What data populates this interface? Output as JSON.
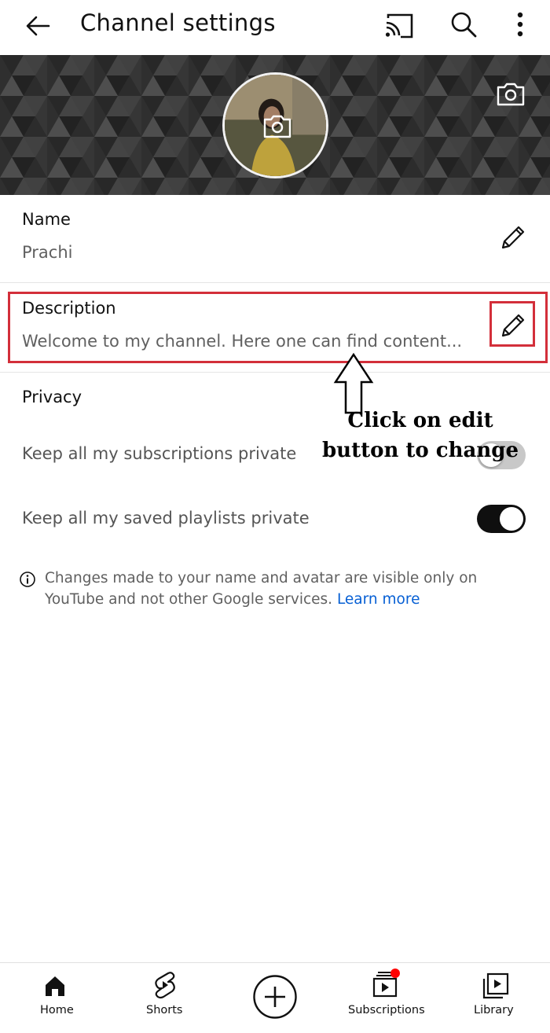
{
  "header": {
    "title": "Channel settings",
    "icons": [
      "back-arrow-icon",
      "cast-icon",
      "search-icon",
      "more-vert-icon"
    ]
  },
  "banner": {
    "icons": [
      "camera-icon"
    ]
  },
  "profile": {
    "name_label": "Name",
    "name_value": "Prachi",
    "description_label": "Description",
    "description_value": "Welcome to my channel. Here one can find content..."
  },
  "annotation": {
    "text_line1": "Click on edit",
    "text_line2": "button to change",
    "color": "#d32f3a"
  },
  "privacy": {
    "heading": "Privacy",
    "subscriptions_label": "Keep all my subscriptions private",
    "subscriptions_on": false,
    "playlists_label": "Keep all my saved playlists private",
    "playlists_on": true
  },
  "info": {
    "text": "Changes made to your name and avatar are visible only on YouTube and not other Google services.",
    "link": "Learn more",
    "link_color": "#065fd4"
  },
  "bottom_nav": {
    "home": "Home",
    "shorts": "Shorts",
    "subscriptions": "Subscriptions",
    "library": "Library",
    "notification_dot_color": "#ff0000"
  }
}
